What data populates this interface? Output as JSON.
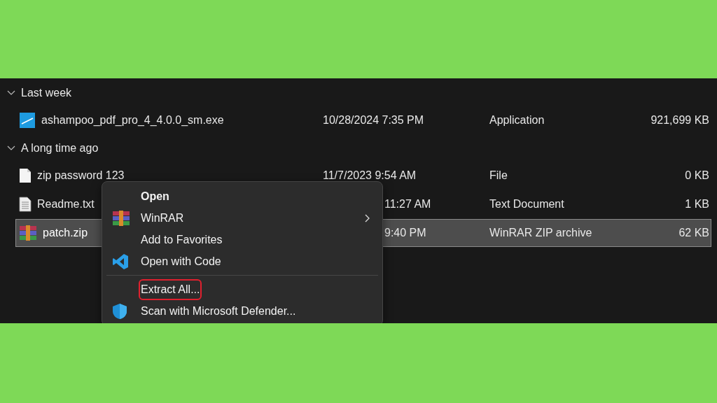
{
  "groups": [
    {
      "label": "Last week",
      "expanded": true,
      "files": [
        {
          "name": "ashampoo_pdf_pro_4_4.0.0_sm.exe",
          "kind": "application",
          "date": "10/28/2024 7:35 PM",
          "date_covered": false,
          "type": "Application",
          "size": "921,699 KB",
          "selected": false
        }
      ]
    },
    {
      "label": "A long time ago",
      "expanded": true,
      "files": [
        {
          "name": "zip password 123",
          "kind": "file",
          "date": "11/7/2023 9:54 AM",
          "date_covered": false,
          "type": "File",
          "size": "0 KB",
          "selected": false
        },
        {
          "name": "Readme.txt",
          "kind": "text",
          "date": "11:27 AM",
          "date_covered": true,
          "type": "Text Document",
          "size": "1 KB",
          "selected": false
        },
        {
          "name": "patch.zip",
          "kind": "archive",
          "date": "9:40 PM",
          "date_covered": true,
          "type": "WinRAR ZIP archive",
          "size": "62 KB",
          "selected": true
        }
      ]
    }
  ],
  "context_menu": {
    "items": [
      {
        "kind": "plain",
        "label": "Open",
        "bold": true,
        "submenu": false,
        "highlighted": false
      },
      {
        "kind": "archive",
        "label": "WinRAR",
        "bold": false,
        "submenu": true,
        "highlighted": false
      },
      {
        "kind": "plain",
        "label": "Add to Favorites",
        "bold": false,
        "submenu": false,
        "highlighted": false
      },
      {
        "kind": "code",
        "label": "Open with Code",
        "bold": false,
        "submenu": false,
        "highlighted": false
      },
      {
        "kind": "separator"
      },
      {
        "kind": "plain",
        "label": "Extract All...",
        "bold": false,
        "submenu": false,
        "highlighted": true
      },
      {
        "kind": "shield",
        "label": "Scan with Microsoft Defender...",
        "bold": false,
        "submenu": false,
        "highlighted": false
      }
    ]
  }
}
